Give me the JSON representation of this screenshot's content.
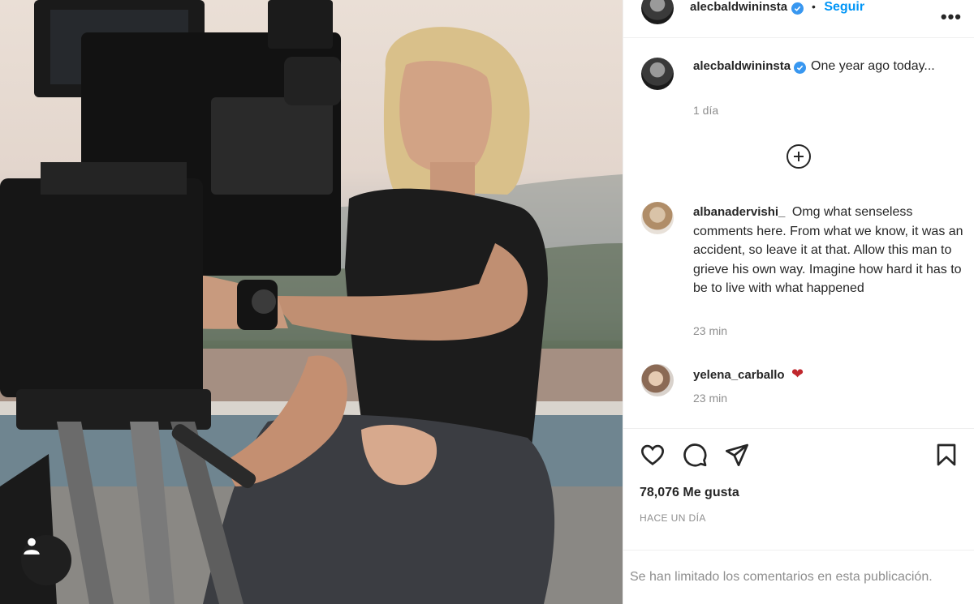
{
  "post": {
    "author": "alecbaldwininsta",
    "follow_label": "Seguir",
    "separator": "•",
    "more_label": "•••"
  },
  "caption": {
    "username": "alecbaldwininsta",
    "text": "One year ago today...",
    "time": "1 día"
  },
  "comments": [
    {
      "username": "albanadervishi_",
      "text": "Omg what senseless comments here. From what we know, it was an accident, so leave it at that. Allow this man to grieve his own way. Imagine how hard it has to be to live with what happened",
      "time": "23 min"
    },
    {
      "username": "yelena_carballo",
      "text": "",
      "emoji": "❤",
      "time": "23 min"
    }
  ],
  "engagement": {
    "likes": "78,076 Me gusta",
    "timestamp": "HACE UN DÍA",
    "comments_limited": "Se han limitado los comentarios en esta publicación."
  },
  "colors": {
    "accent": "#0095f6",
    "verified": "#3897f0",
    "muted": "#8e8e8e",
    "heart_emoji": "#c0272d"
  },
  "icons": [
    "user-tag-icon",
    "verified-badge-icon",
    "more-options-icon",
    "add-comment-icon",
    "like-heart-icon",
    "comment-bubble-icon",
    "share-send-icon",
    "bookmark-save-icon"
  ]
}
